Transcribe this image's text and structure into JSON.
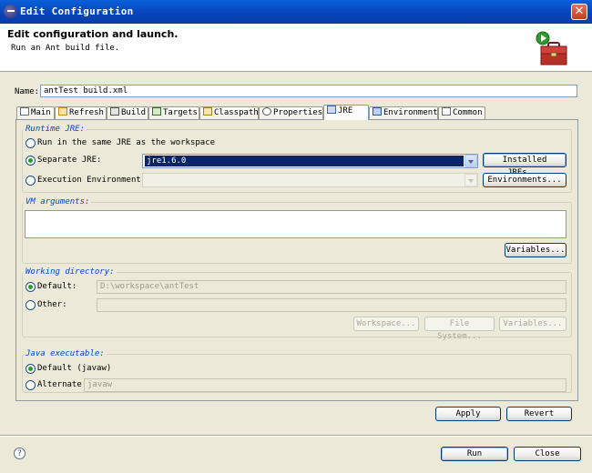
{
  "window": {
    "title": "Edit Configuration"
  },
  "banner": {
    "heading": "Edit configuration and launch.",
    "subheading": "Run an Ant build file."
  },
  "name_field": {
    "label": "Name:",
    "value": "antTest build.xml"
  },
  "tabs": [
    {
      "label": "Main",
      "icon": "main-tab-icon"
    },
    {
      "label": "Refresh",
      "icon": "refresh-icon"
    },
    {
      "label": "Build",
      "icon": "build-icon"
    },
    {
      "label": "Targets",
      "icon": "targets-icon"
    },
    {
      "label": "Classpath",
      "icon": "classpath-icon"
    },
    {
      "label": "Properties",
      "icon": "properties-icon"
    },
    {
      "label": "JRE",
      "icon": "jre-icon",
      "active": true
    },
    {
      "label": "Environment",
      "icon": "environment-icon"
    },
    {
      "label": "Common",
      "icon": "common-icon"
    }
  ],
  "runtime_jre": {
    "group_label": "Runtime JRE:",
    "option_workspace": "Run in the same JRE as the workspace",
    "option_separate": "Separate JRE:",
    "separate_value": "jre1.6.0",
    "option_execution": "Execution Environment:",
    "execution_value": "",
    "installed_button": "Installed JREs...",
    "environments_button": "Environments...",
    "selected": "separate"
  },
  "vm_arguments": {
    "group_label": "VM arguments:",
    "value": "",
    "variables_button": "Variables..."
  },
  "working_directory": {
    "group_label": "Working directory:",
    "option_default": "Default:",
    "default_value": "D:\\workspace\\antTest",
    "option_other": "Other:",
    "other_value": "",
    "workspace_button": "Workspace...",
    "filesystem_button": "File System...",
    "variables_button": "Variables...",
    "selected": "default"
  },
  "java_executable": {
    "group_label": "Java executable:",
    "option_default": "Default (javaw)",
    "option_alternate": "Alternate",
    "alternate_value": "javaw",
    "selected": "default"
  },
  "actions": {
    "apply": "Apply",
    "revert": "Revert",
    "run": "Run",
    "close": "Close"
  },
  "help": {
    "glyph": "?"
  },
  "colors": {
    "titlebar": "#0842b8",
    "selection": "#0a246a",
    "group_label": "#0046d5",
    "radio_dot": "#21a121"
  }
}
